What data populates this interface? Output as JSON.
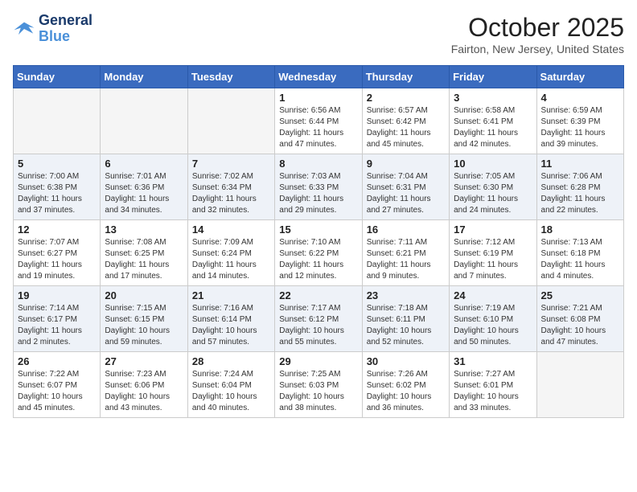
{
  "header": {
    "logo_line1": "General",
    "logo_line2": "Blue",
    "month": "October 2025",
    "location": "Fairton, New Jersey, United States"
  },
  "days_of_week": [
    "Sunday",
    "Monday",
    "Tuesday",
    "Wednesday",
    "Thursday",
    "Friday",
    "Saturday"
  ],
  "weeks": [
    [
      {
        "day": "",
        "sunrise": "",
        "sunset": "",
        "daylight": ""
      },
      {
        "day": "",
        "sunrise": "",
        "sunset": "",
        "daylight": ""
      },
      {
        "day": "",
        "sunrise": "",
        "sunset": "",
        "daylight": ""
      },
      {
        "day": "1",
        "sunrise": "6:56 AM",
        "sunset": "6:44 PM",
        "daylight": "11 hours and 47 minutes."
      },
      {
        "day": "2",
        "sunrise": "6:57 AM",
        "sunset": "6:42 PM",
        "daylight": "11 hours and 45 minutes."
      },
      {
        "day": "3",
        "sunrise": "6:58 AM",
        "sunset": "6:41 PM",
        "daylight": "11 hours and 42 minutes."
      },
      {
        "day": "4",
        "sunrise": "6:59 AM",
        "sunset": "6:39 PM",
        "daylight": "11 hours and 39 minutes."
      }
    ],
    [
      {
        "day": "5",
        "sunrise": "7:00 AM",
        "sunset": "6:38 PM",
        "daylight": "11 hours and 37 minutes."
      },
      {
        "day": "6",
        "sunrise": "7:01 AM",
        "sunset": "6:36 PM",
        "daylight": "11 hours and 34 minutes."
      },
      {
        "day": "7",
        "sunrise": "7:02 AM",
        "sunset": "6:34 PM",
        "daylight": "11 hours and 32 minutes."
      },
      {
        "day": "8",
        "sunrise": "7:03 AM",
        "sunset": "6:33 PM",
        "daylight": "11 hours and 29 minutes."
      },
      {
        "day": "9",
        "sunrise": "7:04 AM",
        "sunset": "6:31 PM",
        "daylight": "11 hours and 27 minutes."
      },
      {
        "day": "10",
        "sunrise": "7:05 AM",
        "sunset": "6:30 PM",
        "daylight": "11 hours and 24 minutes."
      },
      {
        "day": "11",
        "sunrise": "7:06 AM",
        "sunset": "6:28 PM",
        "daylight": "11 hours and 22 minutes."
      }
    ],
    [
      {
        "day": "12",
        "sunrise": "7:07 AM",
        "sunset": "6:27 PM",
        "daylight": "11 hours and 19 minutes."
      },
      {
        "day": "13",
        "sunrise": "7:08 AM",
        "sunset": "6:25 PM",
        "daylight": "11 hours and 17 minutes."
      },
      {
        "day": "14",
        "sunrise": "7:09 AM",
        "sunset": "6:24 PM",
        "daylight": "11 hours and 14 minutes."
      },
      {
        "day": "15",
        "sunrise": "7:10 AM",
        "sunset": "6:22 PM",
        "daylight": "11 hours and 12 minutes."
      },
      {
        "day": "16",
        "sunrise": "7:11 AM",
        "sunset": "6:21 PM",
        "daylight": "11 hours and 9 minutes."
      },
      {
        "day": "17",
        "sunrise": "7:12 AM",
        "sunset": "6:19 PM",
        "daylight": "11 hours and 7 minutes."
      },
      {
        "day": "18",
        "sunrise": "7:13 AM",
        "sunset": "6:18 PM",
        "daylight": "11 hours and 4 minutes."
      }
    ],
    [
      {
        "day": "19",
        "sunrise": "7:14 AM",
        "sunset": "6:17 PM",
        "daylight": "11 hours and 2 minutes."
      },
      {
        "day": "20",
        "sunrise": "7:15 AM",
        "sunset": "6:15 PM",
        "daylight": "10 hours and 59 minutes."
      },
      {
        "day": "21",
        "sunrise": "7:16 AM",
        "sunset": "6:14 PM",
        "daylight": "10 hours and 57 minutes."
      },
      {
        "day": "22",
        "sunrise": "7:17 AM",
        "sunset": "6:12 PM",
        "daylight": "10 hours and 55 minutes."
      },
      {
        "day": "23",
        "sunrise": "7:18 AM",
        "sunset": "6:11 PM",
        "daylight": "10 hours and 52 minutes."
      },
      {
        "day": "24",
        "sunrise": "7:19 AM",
        "sunset": "6:10 PM",
        "daylight": "10 hours and 50 minutes."
      },
      {
        "day": "25",
        "sunrise": "7:21 AM",
        "sunset": "6:08 PM",
        "daylight": "10 hours and 47 minutes."
      }
    ],
    [
      {
        "day": "26",
        "sunrise": "7:22 AM",
        "sunset": "6:07 PM",
        "daylight": "10 hours and 45 minutes."
      },
      {
        "day": "27",
        "sunrise": "7:23 AM",
        "sunset": "6:06 PM",
        "daylight": "10 hours and 43 minutes."
      },
      {
        "day": "28",
        "sunrise": "7:24 AM",
        "sunset": "6:04 PM",
        "daylight": "10 hours and 40 minutes."
      },
      {
        "day": "29",
        "sunrise": "7:25 AM",
        "sunset": "6:03 PM",
        "daylight": "10 hours and 38 minutes."
      },
      {
        "day": "30",
        "sunrise": "7:26 AM",
        "sunset": "6:02 PM",
        "daylight": "10 hours and 36 minutes."
      },
      {
        "day": "31",
        "sunrise": "7:27 AM",
        "sunset": "6:01 PM",
        "daylight": "10 hours and 33 minutes."
      },
      {
        "day": "",
        "sunrise": "",
        "sunset": "",
        "daylight": ""
      }
    ]
  ],
  "labels": {
    "sunrise_prefix": "Sunrise: ",
    "sunset_prefix": "Sunset: ",
    "daylight_prefix": "Daylight: "
  }
}
